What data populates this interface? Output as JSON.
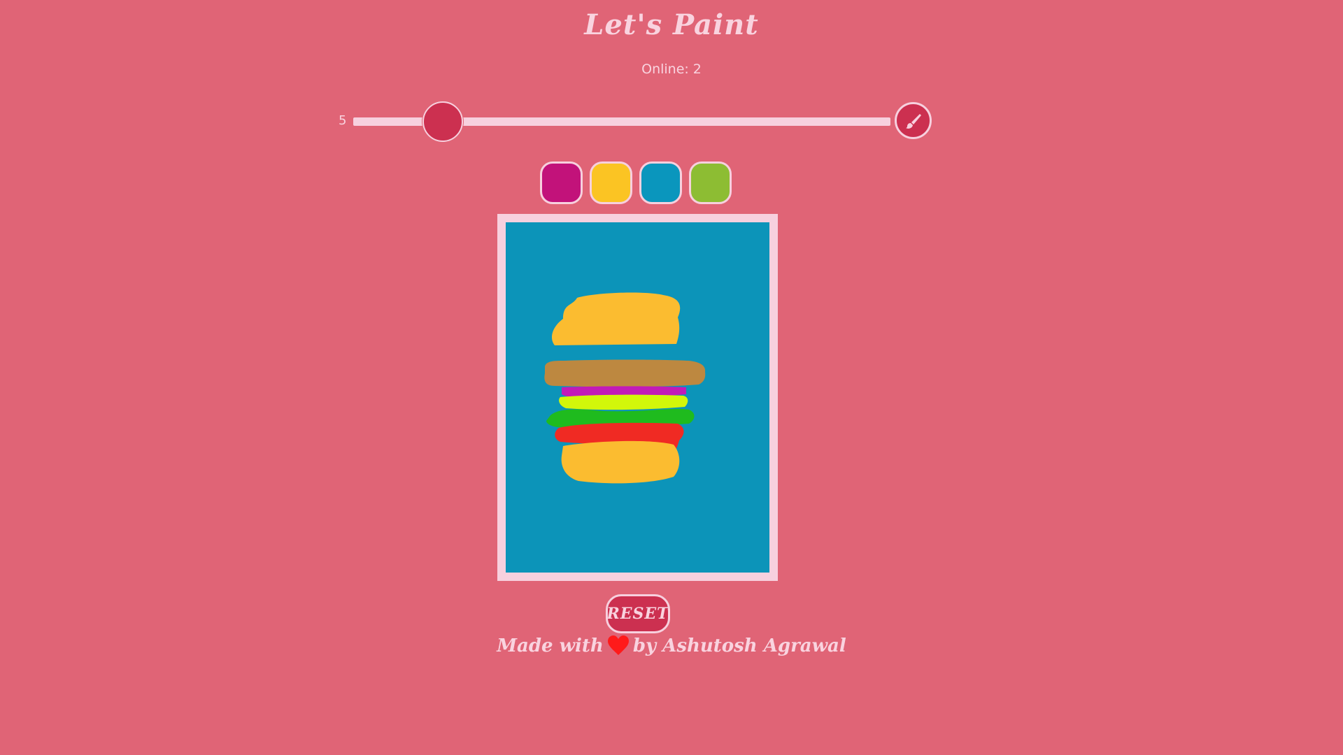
{
  "header": {
    "title": "Let's Paint",
    "online_label": "Online:",
    "online_count": "2"
  },
  "toolbar": {
    "brush_size_value": "5",
    "brush_size_min": 1,
    "brush_size_max": 50,
    "brush_icon": "paintbrush-icon"
  },
  "palette": {
    "colors": [
      "#c2127a",
      "#fbc423",
      "#0a96bd",
      "#8dbd33"
    ]
  },
  "canvas": {
    "background": "#0c94b9",
    "frame_color": "#f7d0de"
  },
  "actions": {
    "reset_label": "RESET"
  },
  "footer": {
    "made_with": "Made with",
    "by_author": "by Ashutosh Agrawal",
    "heart_icon": "heart-icon"
  },
  "theme": {
    "background": "#e06476",
    "accent": "#cc3050",
    "light": "#f7d0de"
  }
}
